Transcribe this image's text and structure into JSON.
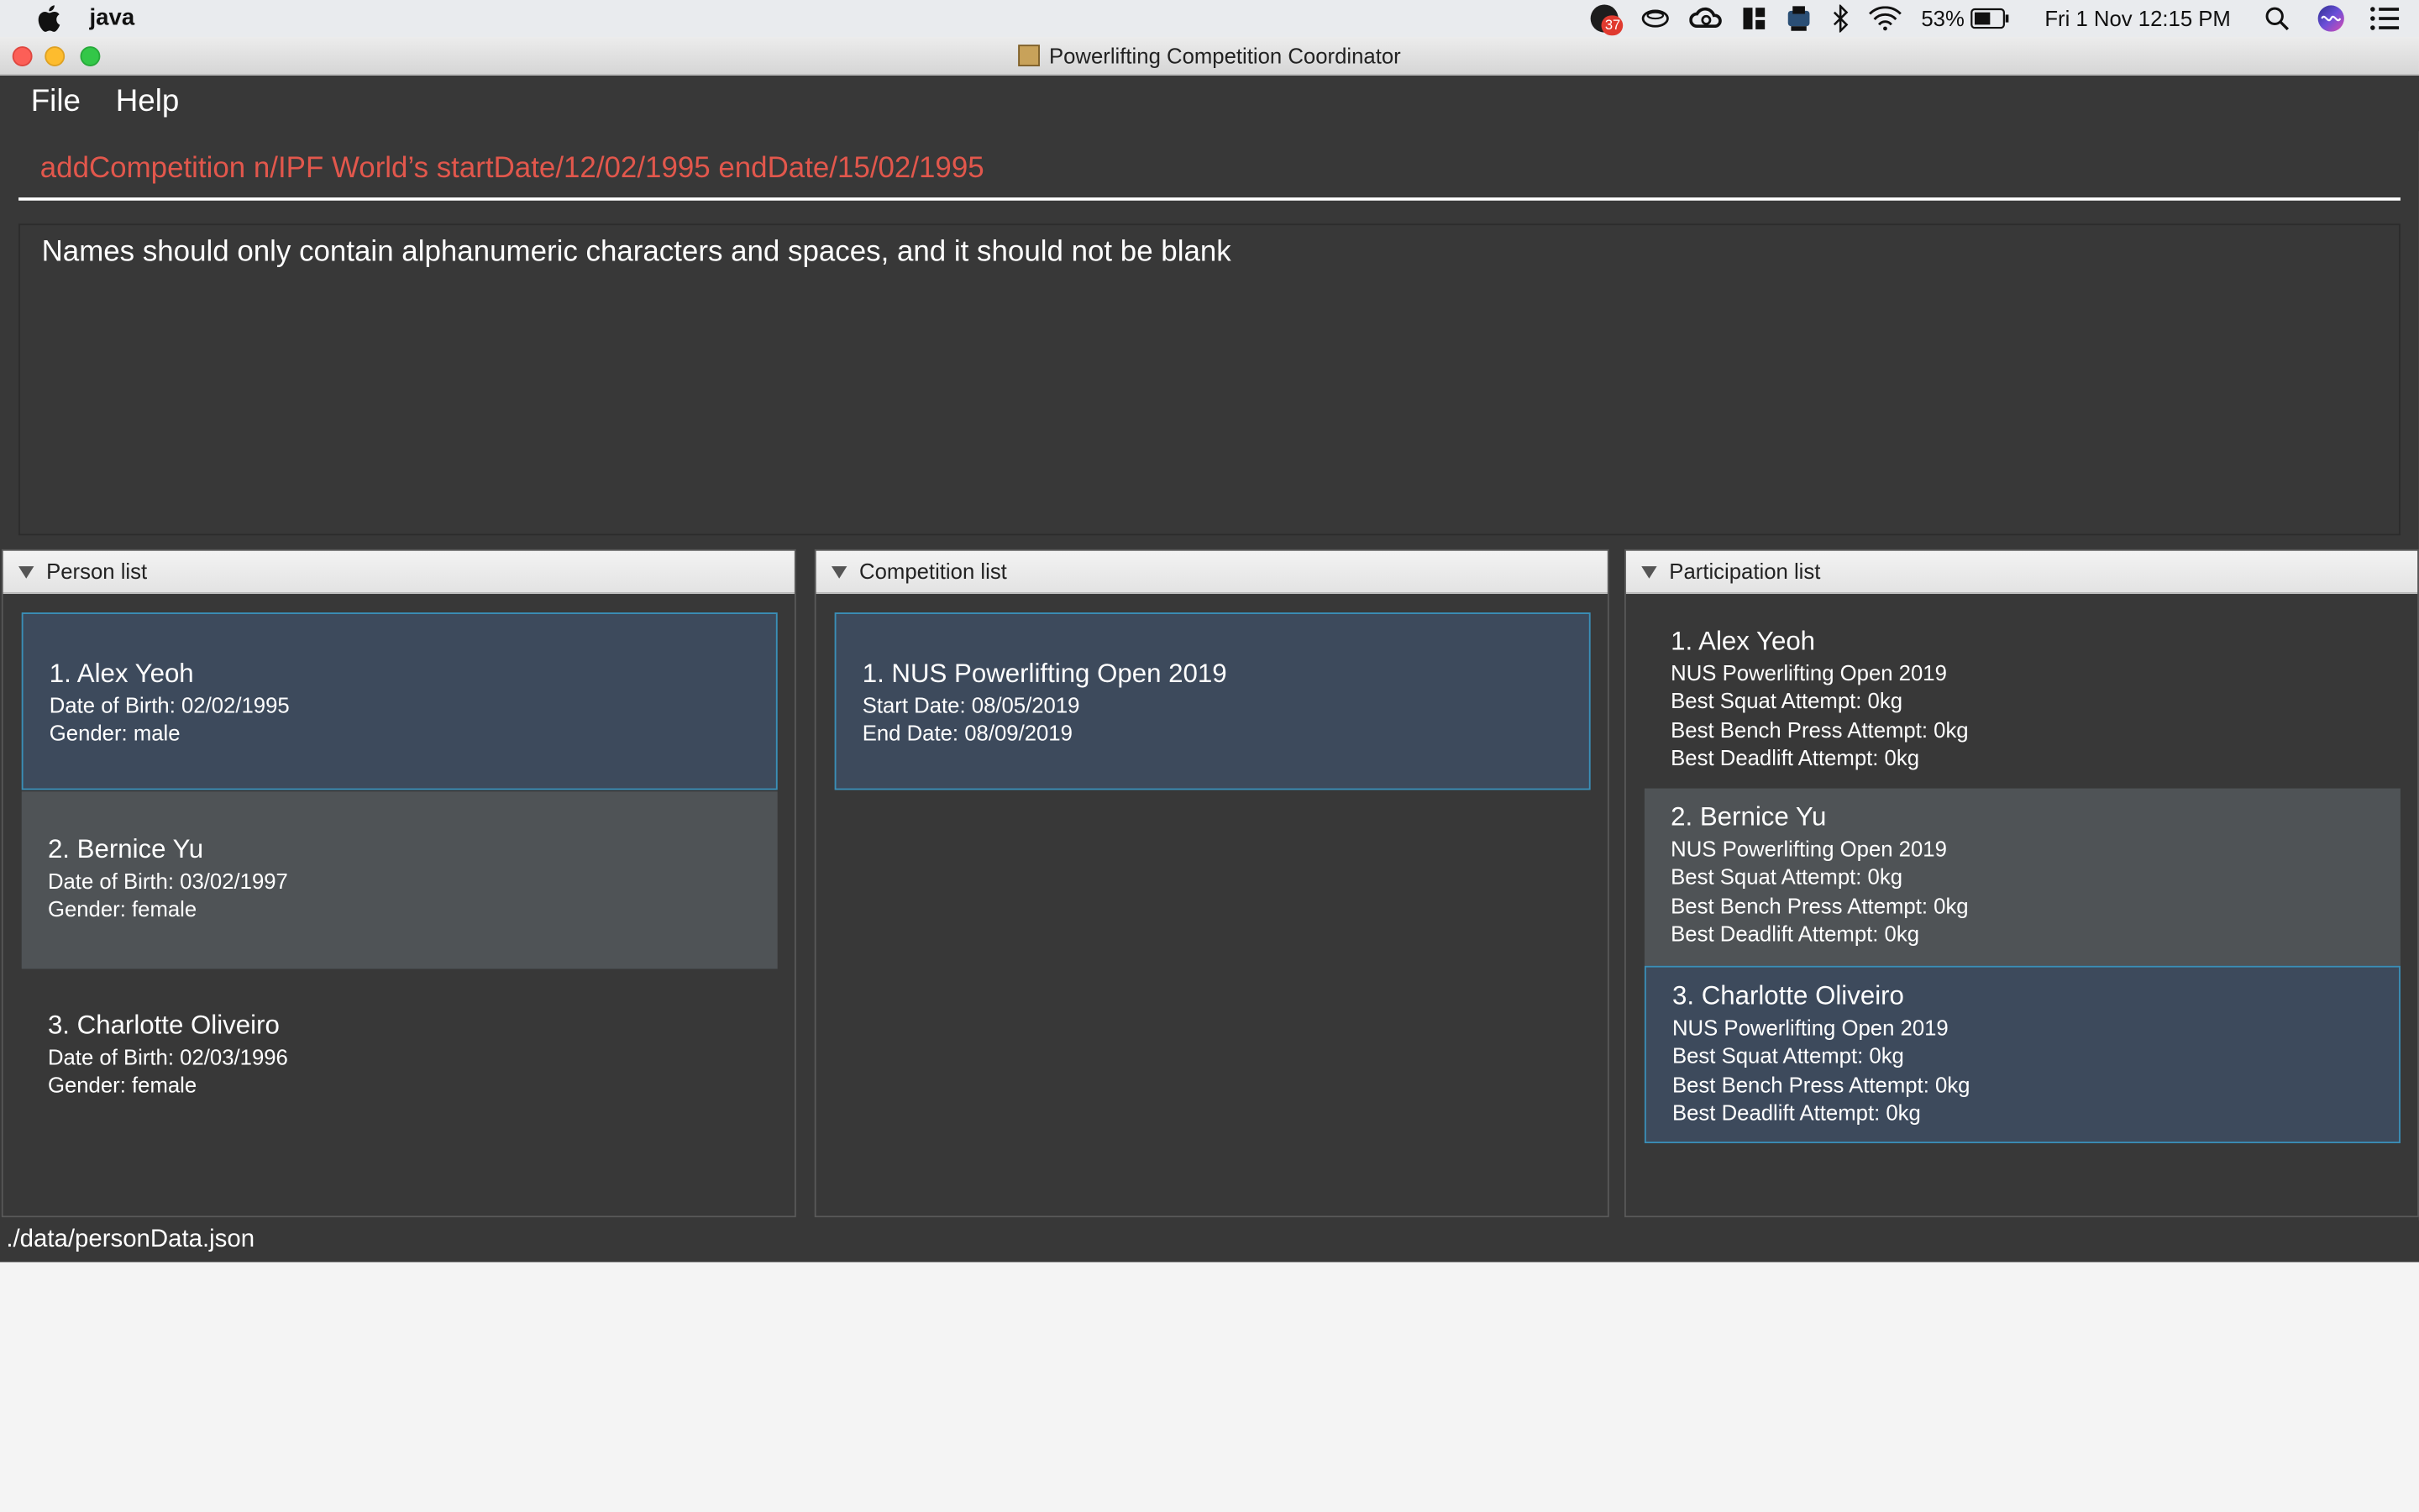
{
  "mac_menubar": {
    "app_name": "java",
    "notification_count": "37",
    "battery": "53%",
    "datetime": "Fri 1 Nov  12:15 PM"
  },
  "window": {
    "title": "Powerlifting Competition Coordinator"
  },
  "menu": {
    "file": "File",
    "help": "Help"
  },
  "command_box": {
    "value": "addCompetition n/IPF World’s startDate/12/02/1995 endDate/15/02/1995"
  },
  "result_display": {
    "text": "Names should only contain alphanumeric characters and spaces, and it should not be blank"
  },
  "person_list": {
    "header": "Person list",
    "items": [
      {
        "title": "1.  Alex Yeoh",
        "dob": "Date of Birth: 02/02/1995",
        "gender": "Gender: male"
      },
      {
        "title": "2.  Bernice Yu",
        "dob": "Date of Birth: 03/02/1997",
        "gender": "Gender: female"
      },
      {
        "title": "3.  Charlotte Oliveiro",
        "dob": "Date of Birth: 02/03/1996",
        "gender": "Gender: female"
      }
    ]
  },
  "competition_list": {
    "header": "Competition list",
    "items": [
      {
        "title": "1.  NUS Powerlifting Open 2019",
        "start": "Start Date: 08/05/2019",
        "end": "End Date: 08/09/2019"
      }
    ]
  },
  "participation_list": {
    "header": "Participation list",
    "items": [
      {
        "title": "1.  Alex Yeoh",
        "competition": "NUS Powerlifting Open 2019",
        "squat": "Best Squat Attempt: 0kg",
        "bench": "Best Bench Press Attempt: 0kg",
        "deadlift": "Best Deadlift Attempt: 0kg"
      },
      {
        "title": "2.  Bernice Yu",
        "competition": "NUS Powerlifting Open 2019",
        "squat": "Best Squat Attempt: 0kg",
        "bench": "Best Bench Press Attempt: 0kg",
        "deadlift": "Best Deadlift Attempt: 0kg"
      },
      {
        "title": "3.  Charlotte Oliveiro",
        "competition": "NUS Powerlifting Open 2019",
        "squat": "Best Squat Attempt: 0kg",
        "bench": "Best Bench Press Attempt: 0kg",
        "deadlift": "Best Deadlift Attempt: 0kg"
      }
    ]
  },
  "status_bar": {
    "path": "./data/personData.json"
  },
  "colors": {
    "background": "#383838",
    "command_text": "#e2574c",
    "selected_card": "#3d4a5c",
    "selected_border": "#3a8fb7",
    "alt_card": "#4f5356"
  }
}
